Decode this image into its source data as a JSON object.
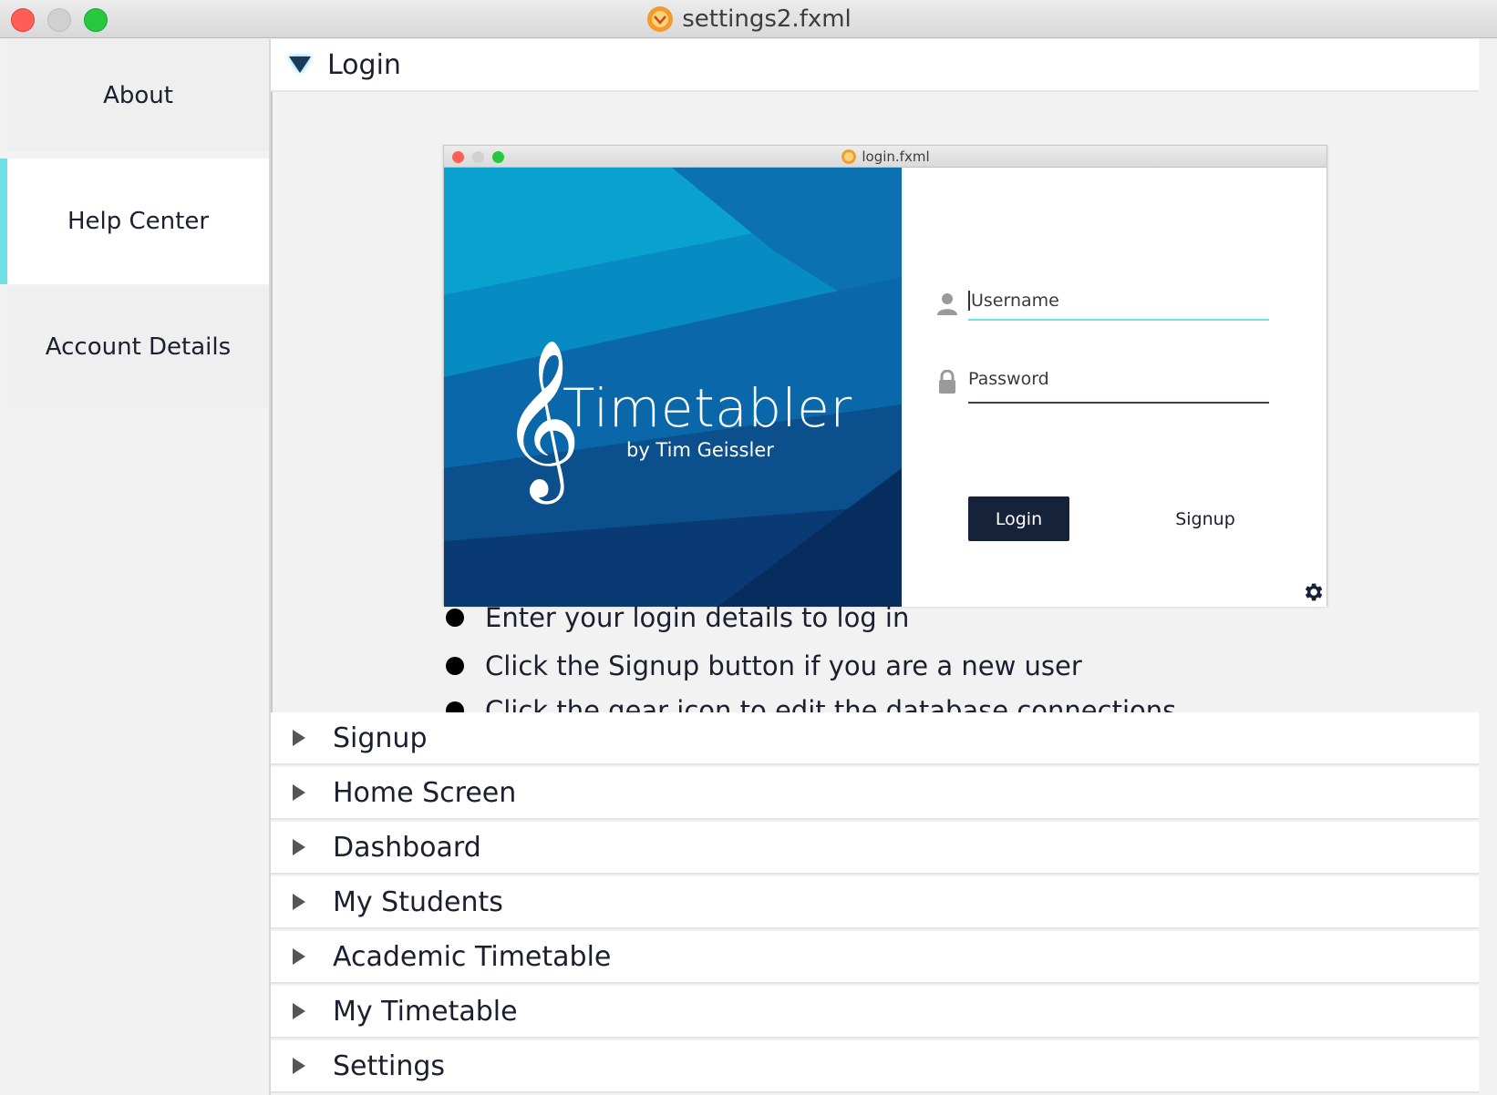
{
  "window": {
    "title": "settings2.fxml"
  },
  "sidebar": {
    "items": [
      {
        "label": "About"
      },
      {
        "label": "Help Center"
      },
      {
        "label": "Account Details"
      }
    ]
  },
  "accordion": {
    "expanded": {
      "title": "Login"
    },
    "collapsed": [
      {
        "title": "Signup"
      },
      {
        "title": "Home Screen"
      },
      {
        "title": "Dashboard"
      },
      {
        "title": "My Students"
      },
      {
        "title": "Academic Timetable"
      },
      {
        "title": "My Timetable"
      },
      {
        "title": "Settings"
      }
    ]
  },
  "login_screenshot": {
    "window_title": "login.fxml",
    "brand": "Timetabler",
    "brand_sub": "by Tim Geissler",
    "username_placeholder": "Username",
    "password_placeholder": "Password",
    "login_button": "Login",
    "signup_button": "Signup"
  },
  "help_points": [
    "Enter your login details to log in",
    "Click the Signup button if you are a new user",
    "Click the gear icon to edit the database connections"
  ],
  "colors": {
    "accent": "#6fe0e4",
    "primary_button": "#16213a",
    "traffic_close": "#fd5f57",
    "traffic_max": "#27c840"
  }
}
